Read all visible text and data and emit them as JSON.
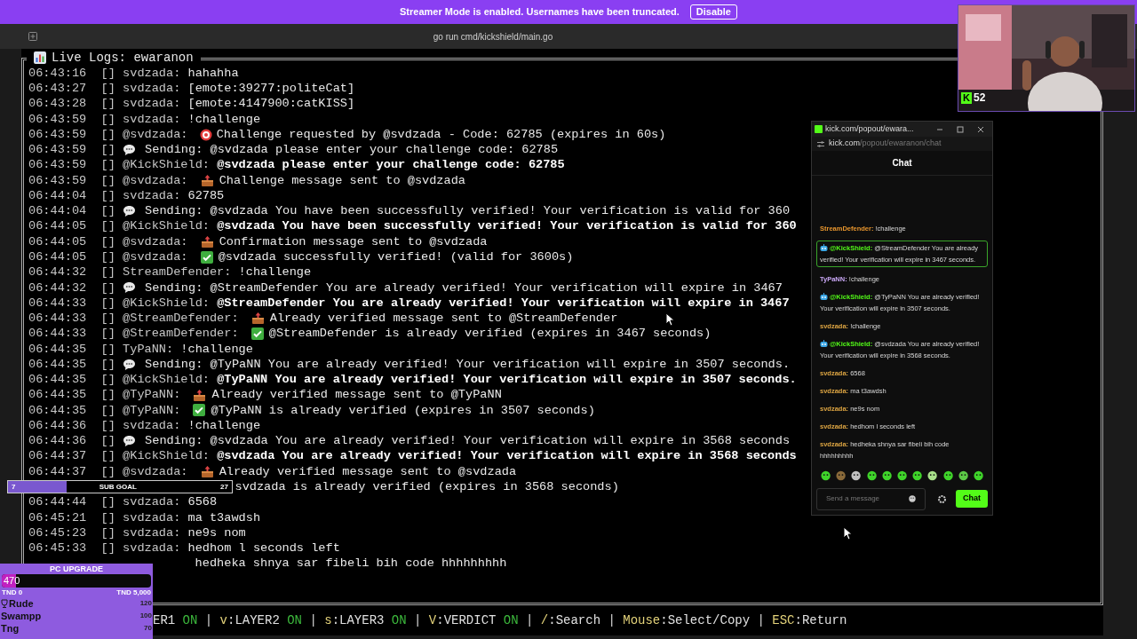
{
  "banner": {
    "text": "Streamer Mode is enabled. Usernames have been truncated.",
    "button": "Disable"
  },
  "terminal": {
    "title": "go run cmd/kickshield/main.go",
    "log_title": "Live Logs: ewaranon",
    "rows": [
      {
        "time": "06:43:16",
        "tag": "[]",
        "user": "svdzada:",
        "kind": "plain",
        "text": "hahahha",
        "bold": false
      },
      {
        "time": "06:43:27",
        "tag": "[]",
        "user": "svdzada:",
        "kind": "plain",
        "text": "[emote:39277:politeCat]",
        "bold": false
      },
      {
        "time": "06:43:28",
        "tag": "[]",
        "user": "svdzada:",
        "kind": "plain",
        "text": "[emote:4147900:catKISS]",
        "bold": false
      },
      {
        "time": "06:43:59",
        "tag": "[]",
        "user": "svdzada:",
        "kind": "plain",
        "text": "!challenge",
        "bold": false
      },
      {
        "time": "06:43:59",
        "tag": "[]",
        "user": "@svdzada:",
        "kind": "target",
        "text": "Challenge requested by @svdzada - Code: 62785 (expires in 60s)",
        "bold": false
      },
      {
        "time": "06:43:59",
        "tag": "[]",
        "kind": "sending",
        "text": "Sending: @svdzada please enter your challenge code: 62785",
        "bold": false
      },
      {
        "time": "06:43:59",
        "tag": "[]",
        "user": "@KickShield:",
        "kind": "plain",
        "text": "@svdzada please enter your challenge code: 62785",
        "bold": true
      },
      {
        "time": "06:43:59",
        "tag": "[]",
        "user": "@svdzada:",
        "kind": "sent",
        "text": "Challenge message sent to @svdzada",
        "bold": false
      },
      {
        "time": "06:44:04",
        "tag": "[]",
        "user": "svdzada:",
        "kind": "plain",
        "text": "62785",
        "bold": false
      },
      {
        "time": "06:44:04",
        "tag": "[]",
        "kind": "sending",
        "text": "Sending: @svdzada You have been successfully verified! Your verification is valid for 360",
        "bold": false
      },
      {
        "time": "06:44:05",
        "tag": "[]",
        "user": "@KickShield:",
        "kind": "plain",
        "text": "@svdzada You have been successfully verified! Your verification is valid for 360",
        "bold": true
      },
      {
        "time": "06:44:05",
        "tag": "[]",
        "user": "@svdzada:",
        "kind": "sent",
        "text": "Confirmation message sent to @svdzada",
        "bold": false
      },
      {
        "time": "06:44:05",
        "tag": "[]",
        "user": "@svdzada:",
        "kind": "verified",
        "text": "@svdzada successfully verified! (valid for 3600s)",
        "bold": false
      },
      {
        "time": "06:44:32",
        "tag": "[]",
        "user": "StreamDefender:",
        "kind": "plain",
        "text": "!challenge",
        "bold": false
      },
      {
        "time": "06:44:32",
        "tag": "[]",
        "kind": "sending",
        "text": "Sending: @StreamDefender You are already verified! Your verification will expire in 3467",
        "bold": false
      },
      {
        "time": "06:44:33",
        "tag": "[]",
        "user": "@KickShield:",
        "kind": "plain",
        "text": "@StreamDefender You are already verified! Your verification will expire in 3467",
        "bold": true
      },
      {
        "time": "06:44:33",
        "tag": "[]",
        "user": "@StreamDefender:",
        "kind": "sent",
        "text": "Already verified message sent to @StreamDefender",
        "bold": false
      },
      {
        "time": "06:44:33",
        "tag": "[]",
        "user": "@StreamDefender:",
        "kind": "verified",
        "text": "@StreamDefender is already verified (expires in 3467 seconds)",
        "bold": false
      },
      {
        "time": "06:44:35",
        "tag": "[]",
        "user": "TyPaNN:",
        "kind": "plain",
        "text": "!challenge",
        "bold": false
      },
      {
        "time": "06:44:35",
        "tag": "[]",
        "kind": "sending",
        "text": "Sending: @TyPaNN You are already verified! Your verification will expire in 3507 seconds.",
        "bold": false
      },
      {
        "time": "06:44:35",
        "tag": "[]",
        "user": "@KickShield:",
        "kind": "plain",
        "text": "@TyPaNN You are already verified! Your verification will expire in 3507 seconds.",
        "bold": true
      },
      {
        "time": "06:44:35",
        "tag": "[]",
        "user": "@TyPaNN:",
        "kind": "sent",
        "text": "Already verified message sent to @TyPaNN",
        "bold": false
      },
      {
        "time": "06:44:35",
        "tag": "[]",
        "user": "@TyPaNN:",
        "kind": "verified",
        "text": "@TyPaNN is already verified (expires in 3507 seconds)",
        "bold": false
      },
      {
        "time": "06:44:36",
        "tag": "[]",
        "user": "svdzada:",
        "kind": "plain",
        "text": "!challenge",
        "bold": false
      },
      {
        "time": "06:44:36",
        "tag": "[]",
        "kind": "sending",
        "text": "Sending: @svdzada You are already verified! Your verification will expire in 3568 seconds",
        "bold": false
      },
      {
        "time": "06:44:37",
        "tag": "[]",
        "user": "@KickShield:",
        "kind": "plain",
        "text": "@svdzada You are already verified! Your verification will expire in 3568 seconds",
        "bold": true
      },
      {
        "time": "06:44:37",
        "tag": "[]",
        "user": "@svdzada:",
        "kind": "sent",
        "text": "Already verified message sent to @svdzada",
        "bold": false
      },
      {
        "kind": "covered_verified",
        "text": "svdzada is already verified (expires in 3568 seconds)",
        "bold": false
      },
      {
        "time": "06:44:44",
        "tag": "[]",
        "user": "svdzada:",
        "kind": "plain",
        "text": "6568",
        "bold": false
      },
      {
        "time": "06:45:21",
        "tag": "[]",
        "user": "svdzada:",
        "kind": "plain",
        "text": "ma t3awdsh",
        "bold": false
      },
      {
        "time": "06:45:23",
        "tag": "[]",
        "user": "svdzada:",
        "kind": "plain",
        "text": "ne9s nom",
        "bold": false
      },
      {
        "time": "06:45:33",
        "tag": "[]",
        "user": "svdzada:",
        "kind": "plain",
        "text": "hedhom l seconds left",
        "bold": false
      },
      {
        "kind": "covered_plain",
        "text": "hedheka shnya sar fibeli bih code hhhhhhhhh",
        "bold": false
      }
    ],
    "status_separator": "|",
    "status_items": [
      {
        "label": "ER1",
        "state": "ON"
      },
      {
        "key": "v",
        "label": ":LAYER2",
        "state": "ON"
      },
      {
        "key": "s",
        "label": ":LAYER3",
        "state": "ON"
      },
      {
        "key": "V",
        "label": ":VERDICT",
        "state": "ON"
      },
      {
        "key": "/",
        "label": ":Search"
      },
      {
        "key": "Mouse",
        "label": ":Select/Copy"
      },
      {
        "key": "ESC",
        "label": ":Return"
      }
    ]
  },
  "chat_window": {
    "title": "kick.com/popout/ewara...",
    "url_host": "kick.com",
    "url_path": "/popout/ewaranon/chat",
    "header": "Chat",
    "messages": [
      {
        "kind": "user",
        "name": "StreamDefender:",
        "color": "#e8962e",
        "text": "!challenge",
        "highlighted": false
      },
      {
        "kind": "bot",
        "name": "@KickShield:",
        "color": "#53fc18",
        "text": "@StreamDefender You are already verified! Your verification will expire in 3467 seconds.",
        "highlighted": true
      },
      {
        "kind": "user",
        "name": "TyPaNN:",
        "color": "#c9a7f5",
        "text": "!challenge",
        "highlighted": false
      },
      {
        "kind": "bot",
        "name": "@KickShield:",
        "color": "#53fc18",
        "text": "@TyPaNN You are already verified! Your verification will expire in 3507 seconds.",
        "highlighted": false
      },
      {
        "kind": "user",
        "name": "svdzada:",
        "color": "#dca442",
        "text": "!challenge",
        "highlighted": false
      },
      {
        "kind": "bot",
        "name": "@KickShield:",
        "color": "#53fc18",
        "text": "@svdzada You are already verified! Your verification will expire in 3568 seconds.",
        "highlighted": false
      },
      {
        "kind": "user",
        "name": "svdzada:",
        "color": "#dca442",
        "text": "6568",
        "highlighted": false
      },
      {
        "kind": "user",
        "name": "svdzada:",
        "color": "#dca442",
        "text": "ma t3awdsh",
        "highlighted": false
      },
      {
        "kind": "user",
        "name": "svdzada:",
        "color": "#dca442",
        "text": "ne9s nom",
        "highlighted": false
      },
      {
        "kind": "user",
        "name": "svdzada:",
        "color": "#dca442",
        "text": "hedhom l seconds left",
        "highlighted": false
      },
      {
        "kind": "user",
        "name": "svdzada:",
        "color": "#dca442",
        "text": "hedheka shnya sar fibeli bih code hhhhhhhhh",
        "highlighted": false
      }
    ],
    "placeholder": "Send a message",
    "send_button": "Chat"
  },
  "webcam": {
    "badge_letter": "K",
    "badge_count": "52"
  },
  "sub_goal": {
    "current": "7",
    "label": "SUB GOAL",
    "target": "27",
    "level": 0.26
  },
  "pc_upgrade": {
    "title": "PC UPGRADE",
    "amount": "470",
    "level": 0.094,
    "min_label": "TND 0",
    "max_label": "TND 5,000",
    "leaders": [
      {
        "name": "Rude",
        "amount": "120",
        "top": true
      },
      {
        "name": "Swampp",
        "amount": "100",
        "top": false
      },
      {
        "name": "Tng",
        "amount": "70",
        "top": false
      }
    ]
  }
}
